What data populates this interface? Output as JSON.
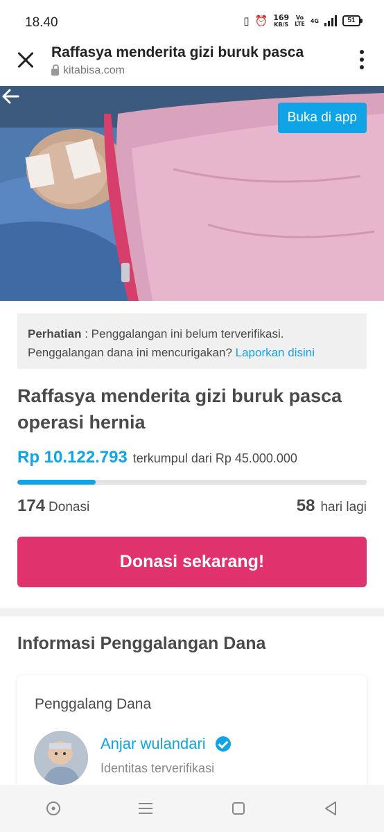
{
  "status_bar": {
    "time": "18.40",
    "net_speed_top": "169",
    "net_speed_unit": "KB/S",
    "volte_top": "Vo",
    "volte_bottom": "LTE",
    "network": "4G",
    "battery": "51"
  },
  "browser": {
    "page_title": "Raffasya menderita gizi buruk pasca",
    "url": "kitabisa.com"
  },
  "hero": {
    "open_in_app_label": "Buka di app"
  },
  "notice": {
    "label": "Perhatian",
    "text": " : Penggalangan ini belum terverifikasi. Penggalangan dana ini mencurigakan? ",
    "link": "Laporkan disini"
  },
  "campaign": {
    "title": "Raffasya menderita gizi buruk pasca operasi hernia",
    "amount_collected": "Rp 10.122.793",
    "amount_target_text": "terkumpul dari Rp 45.000.000",
    "progress_fraction": 0.225,
    "donations_count": "174",
    "donations_label": "Donasi",
    "days_left": "58",
    "days_left_label": "hari lagi",
    "donate_button_label": "Donasi sekarang!"
  },
  "info_section": {
    "title": "Informasi Penggalangan Dana",
    "card_heading": "Penggalang Dana",
    "fundraiser_name": "Anjar wulandari",
    "fundraiser_status": "Identitas terverifikasi"
  },
  "colors": {
    "accent_blue": "#10a4e7",
    "donate_pink": "#e0336e"
  },
  "icons": [
    "close-icon",
    "lock-icon",
    "more-vert-icon",
    "back-arrow-icon",
    "verified-check-icon",
    "home-circle-icon",
    "menu-lines-icon",
    "square-icon",
    "back-triangle-icon"
  ]
}
